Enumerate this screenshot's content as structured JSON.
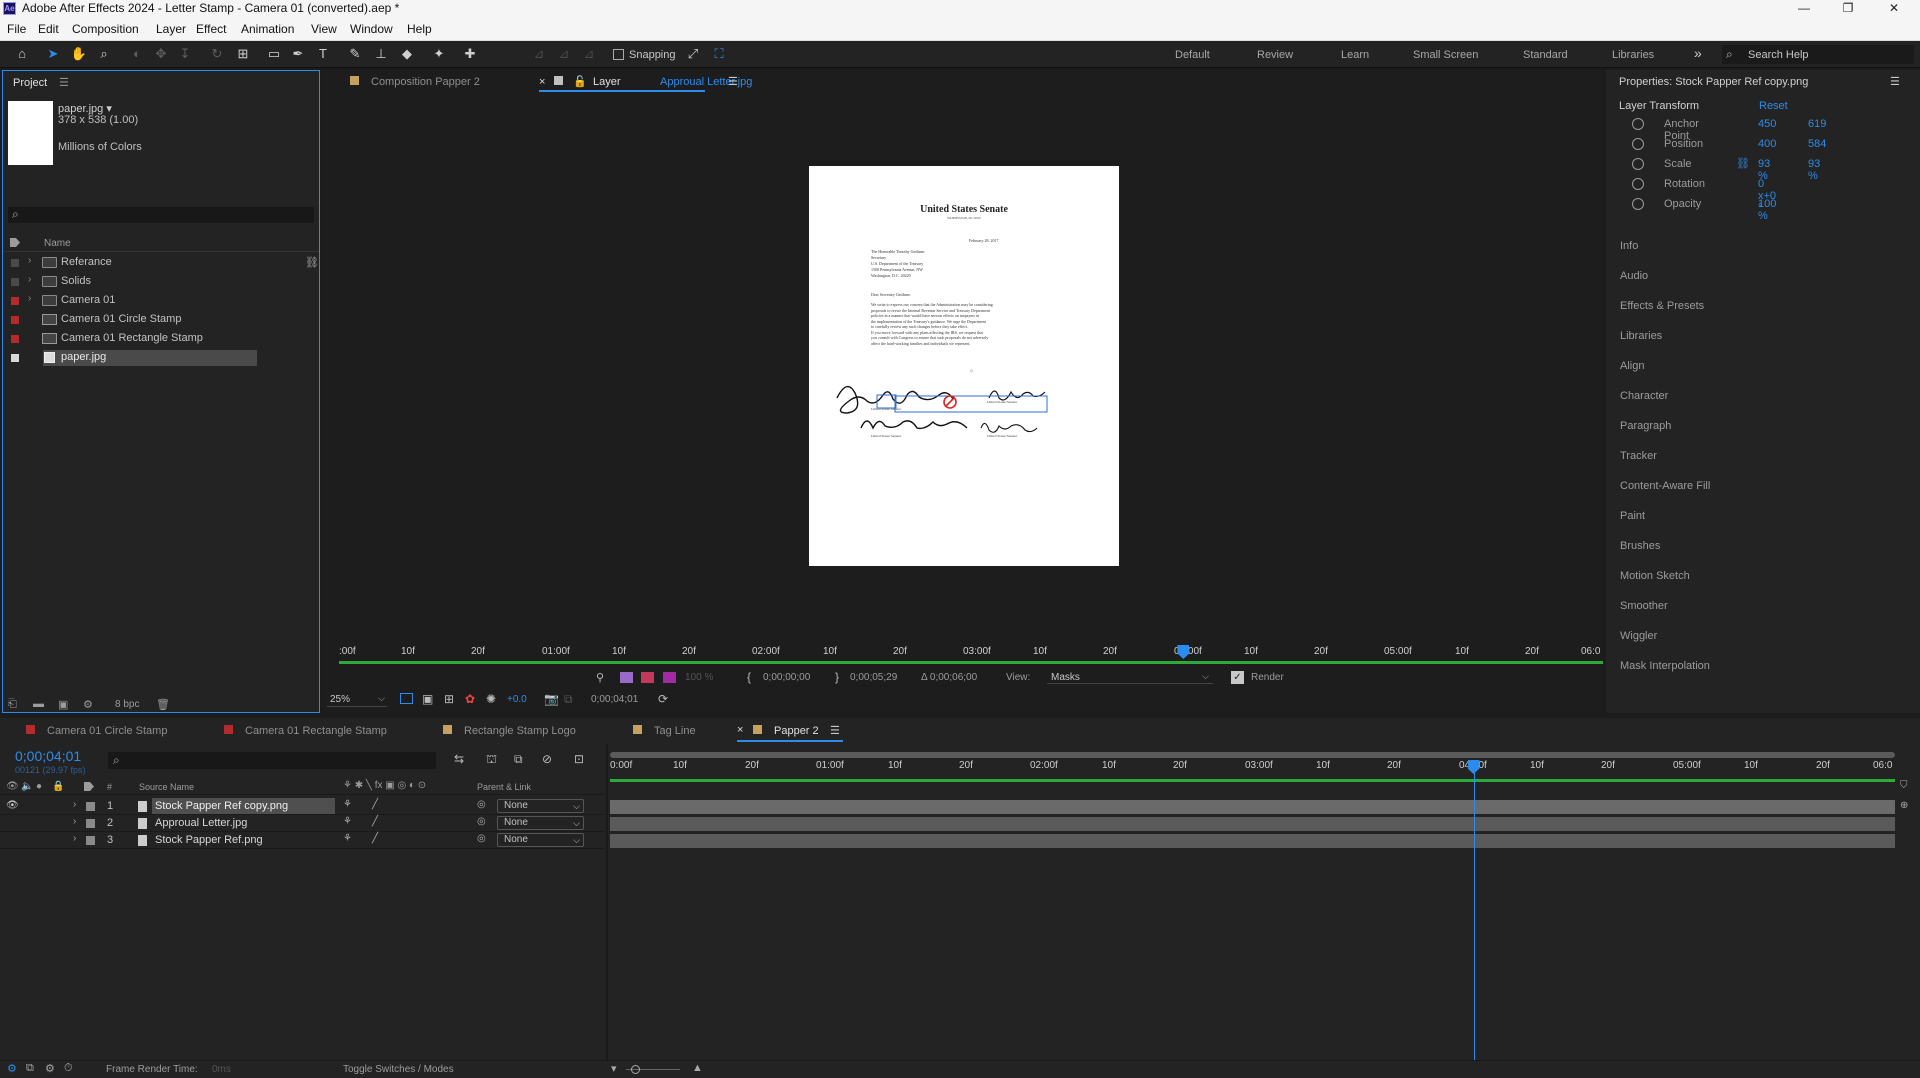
{
  "window": {
    "title": "Adobe After Effects 2024 - Letter Stamp - Camera 01 (converted).aep *",
    "app_icon_text": "Ae",
    "controls": [
      "—",
      "❐",
      "✕"
    ]
  },
  "menu": [
    "File",
    "Edit",
    "Composition",
    "Layer",
    "Effect",
    "Animation",
    "View",
    "Window",
    "Help"
  ],
  "toolbar": {
    "snapping_label": "Snapping",
    "workspaces": [
      "Default",
      "Review",
      "Learn",
      "Small Screen",
      "Standard",
      "Libraries"
    ],
    "overflow": "»",
    "search_placeholder": "Search Help"
  },
  "project": {
    "tab_label": "Project",
    "menu_icon": "☰",
    "asset": {
      "name": "paper.jpg ▾",
      "dims": "378 x 538 (1.00)",
      "colors": "Millions of Colors"
    },
    "search_icon": "⌕",
    "column_name": "Name",
    "items": [
      {
        "name": "Referance",
        "type": "folder",
        "color": "#4a4a4a",
        "twirl": "›"
      },
      {
        "name": "Solids",
        "type": "folder",
        "color": "#4a4a4a",
        "twirl": "›"
      },
      {
        "name": "Camera 01",
        "type": "folder",
        "color": "#b52a2a",
        "twirl": "›"
      },
      {
        "name": "Camera 01 Circle Stamp",
        "type": "comp",
        "color": "#b52a2a",
        "twirl": ""
      },
      {
        "name": "Camera 01 Rectangle Stamp",
        "type": "comp",
        "color": "#b52a2a",
        "twirl": ""
      },
      {
        "name": "paper.jpg",
        "type": "file",
        "color": "#d8d8d8",
        "twirl": "",
        "selected": true
      }
    ],
    "bpc": "8 bpc"
  },
  "viewer": {
    "tab_inactive": "Composition Papper 2",
    "tab_prefix": "Layer",
    "tab_active_name": "Approual Letter.jpg",
    "ruler_labels": [
      ":00f",
      "10f",
      "20f",
      "01:00f",
      "10f",
      "20f",
      "02:00f",
      "10f",
      "20f",
      "03:00f",
      "10f",
      "20f",
      "04:00f",
      "10f",
      "20f",
      "05:00f",
      "10f",
      "20f",
      "06:0"
    ],
    "playhead_position": 0.668,
    "controls": {
      "in_point": "0;00;00;00",
      "out_point": "0;00;05;29",
      "duration": "Δ 0;00;06;00",
      "view_label": "View:",
      "view_value": "Masks",
      "render_label": "Render",
      "zoom": "25%",
      "exposure": "+0.0",
      "timecode": "0;00;04;01",
      "opacity_pct": "100 %"
    },
    "document": {
      "heading": "United States Senate",
      "subheading": "WASHINGTON, DC 20510",
      "date": "February 28, 2017",
      "address": [
        "The Honorable Timothy Geithner",
        "Secretary",
        "U.S. Department of the Treasury",
        "1500 Pennsylvania Avenue, NW",
        "Washington, D.C. 20220"
      ],
      "salutation": "Dear Secretary Geithner:",
      "body": [
        "We write to express our concern that the Administration may be considering",
        "proposals to revise the Internal Revenue Service and Treasury Department",
        "policies in a manner that would have serious effects on taxpayers in",
        "the implementation of the Treasury's guidance. We urge the Department",
        "to carefully review any such changes before they take effect.",
        "",
        "If you move forward with any plans affecting the IRS, we request that",
        "you consult with Congress to ensure that such proposals do not adversely",
        "affect the hard-working families and individuals we represent."
      ],
      "sig_names": [
        "United States Senator",
        "United States Senator",
        "United States Senator",
        "United States Senator"
      ]
    }
  },
  "properties": {
    "title": "Properties: Stock Papper Ref copy.png",
    "menu_icon": "☰",
    "section": "Layer Transform",
    "reset": "Reset",
    "rows": [
      {
        "label": "Anchor Point",
        "v1": "450",
        "v2": "619"
      },
      {
        "label": "Position",
        "v1": "400",
        "v2": "584"
      },
      {
        "label": "Scale",
        "v1": "93 %",
        "v2": "93 %",
        "link": true
      },
      {
        "label": "Rotation",
        "v1": "0 x+0 °",
        "v2": ""
      },
      {
        "label": "Opacity",
        "v1": "100 %",
        "v2": ""
      }
    ],
    "panels": [
      "Info",
      "Audio",
      "Effects & Presets",
      "Libraries",
      "Align",
      "Character",
      "Paragraph",
      "Tracker",
      "Content-Aware Fill",
      "Paint",
      "Brushes",
      "Motion Sketch",
      "Smoother",
      "Wiggler",
      "Mask Interpolation"
    ]
  },
  "timeline": {
    "tabs": [
      {
        "label": "Camera 01 Circle Stamp",
        "color": "#b52a2a",
        "active": false
      },
      {
        "label": "Camera 01 Rectangle Stamp",
        "color": "#b52a2a",
        "active": false
      },
      {
        "label": "Rectangle Stamp Logo",
        "color": "#c8a060",
        "active": false
      },
      {
        "label": "Tag Line",
        "color": "#c8a060",
        "active": false
      },
      {
        "label": "Papper 2",
        "color": "#c8a060",
        "active": true
      }
    ],
    "timecode": "0;00;04;01",
    "frame_info": "00121 (29.97 fps)",
    "columns": {
      "hash": "#",
      "source": "Source Name",
      "parent": "Parent & Link"
    },
    "layers": [
      {
        "num": "1",
        "name": "Stock Papper Ref copy.png",
        "parent": "None",
        "selected": true
      },
      {
        "num": "2",
        "name": "Approual Letter.jpg",
        "parent": "None",
        "selected": false
      },
      {
        "num": "3",
        "name": "Stock Papper Ref.png",
        "parent": "None",
        "selected": false
      }
    ],
    "ruler_labels": [
      "0:00f",
      "10f",
      "20f",
      "01:00f",
      "10f",
      "20f",
      "02:00f",
      "10f",
      "20f",
      "03:00f",
      "10f",
      "20f",
      "04:00f",
      "10f",
      "20f",
      "05:00f",
      "10f",
      "20f",
      "06:0"
    ],
    "playhead_position": 0.672,
    "status": {
      "frame_render": "Frame Render Time:",
      "frame_render_value": "0ms",
      "toggle": "Toggle Switches / Modes"
    }
  }
}
